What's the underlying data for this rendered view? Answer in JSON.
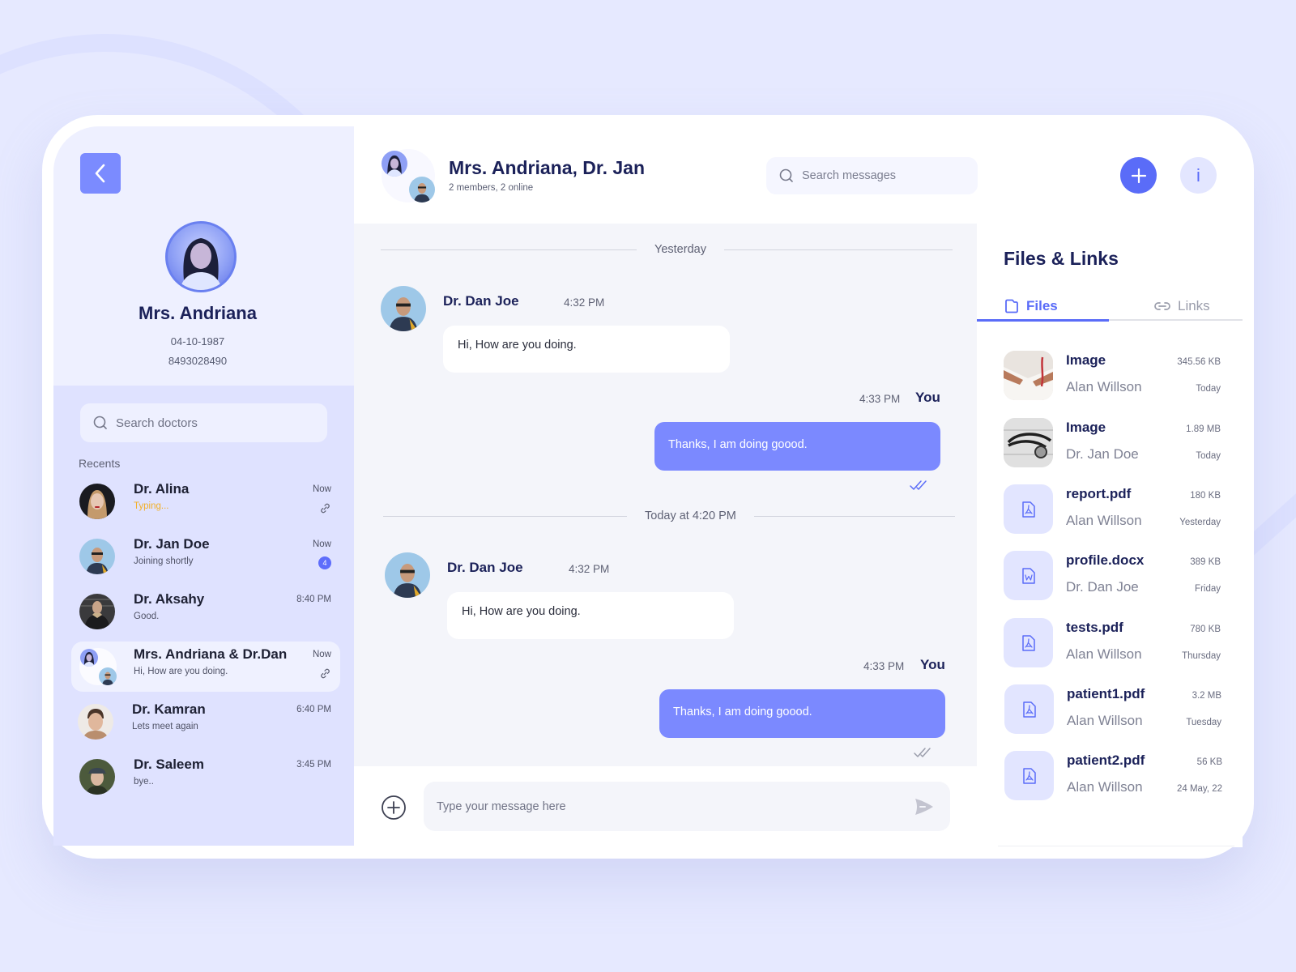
{
  "colors": {
    "accent": "#5a6cf8",
    "bubble_out": "#7b89ff",
    "typing": "#f2b02a",
    "page_bg": "#e6e9ff",
    "sidebar_bg": "#dfe2ff"
  },
  "profile": {
    "back_icon": "chevron-left-icon",
    "name": "Mrs. Andriana",
    "dob": "04-10-1987",
    "phone": "8493028490"
  },
  "sidebar": {
    "search_placeholder": "Search doctors",
    "recents_label": "Recents",
    "contacts": [
      {
        "name": "Dr. Alina",
        "message": "Typing...",
        "time": "Now",
        "extra": "link-icon",
        "typing": true
      },
      {
        "name": "Dr. Jan Doe",
        "message": "Joining shortly",
        "time": "Now",
        "unread": "4"
      },
      {
        "name": "Dr. Aksahy",
        "message": "Good.",
        "time": "8:40 PM"
      },
      {
        "name": "Mrs. Andriana & Dr.Dan",
        "message": "Hi, How are you doing.",
        "time": "Now",
        "extra": "link-icon",
        "active": true
      },
      {
        "name": "Dr. Kamran",
        "message": "Lets meet again",
        "time": "6:40 PM"
      },
      {
        "name": "Dr. Saleem",
        "message": "bye..",
        "time": "3:45 PM"
      }
    ]
  },
  "header": {
    "title": "Mrs. Andriana, Dr. Jan",
    "subtitle": "2 members, 2 online",
    "search_placeholder": "Search messages",
    "add_icon": "plus-icon",
    "info_label": "i"
  },
  "chat": {
    "groups": [
      {
        "divider": "Yesterday",
        "incoming": {
          "sender": "Dr. Dan Joe",
          "time": "4:32 PM",
          "text": "Hi, How are you doing."
        },
        "outgoing": {
          "sender": "You",
          "time": "4:33 PM",
          "text": "Thanks, I am doing goood.",
          "status": "read"
        }
      },
      {
        "divider": "Today at 4:20 PM",
        "incoming": {
          "sender": "Dr. Dan Joe",
          "time": "4:32 PM",
          "text": "Hi, How are you doing."
        },
        "outgoing": {
          "sender": "You",
          "time": "4:33 PM",
          "text": "Thanks, I am doing goood.",
          "status": "delivered"
        }
      }
    ]
  },
  "composer": {
    "placeholder": "Type your message here",
    "attach_icon": "plus-circle-icon",
    "send_icon": "send-icon"
  },
  "files_panel": {
    "title": "Files & Links",
    "tabs": [
      {
        "label": "Files",
        "icon": "folder-icon",
        "active": true
      },
      {
        "label": "Links",
        "icon": "link-icon",
        "active": false
      }
    ],
    "files": [
      {
        "name": "Image",
        "owner": "Alan Willson",
        "size": "345.56 KB",
        "date": "Today",
        "type": "image-doctor"
      },
      {
        "name": "Image",
        "owner": "Dr. Jan Doe",
        "size": "1.89 MB",
        "date": "Today",
        "type": "image-stethoscope"
      },
      {
        "name": "report.pdf",
        "owner": "Alan Willson",
        "size": "180 KB",
        "date": "Yesterday",
        "type": "pdf"
      },
      {
        "name": "profile.docx",
        "owner": "Dr. Dan Joe",
        "size": "389 KB",
        "date": "Friday",
        "type": "docx"
      },
      {
        "name": "tests.pdf",
        "owner": "Alan Willson",
        "size": "780 KB",
        "date": "Thursday",
        "type": "pdf"
      },
      {
        "name": "patient1.pdf",
        "owner": "Alan Willson",
        "size": "3.2 MB",
        "date": "Tuesday",
        "type": "pdf"
      },
      {
        "name": "patient2.pdf",
        "owner": "Alan Willson",
        "size": "56 KB",
        "date": "24 May, 22",
        "type": "pdf"
      }
    ]
  }
}
